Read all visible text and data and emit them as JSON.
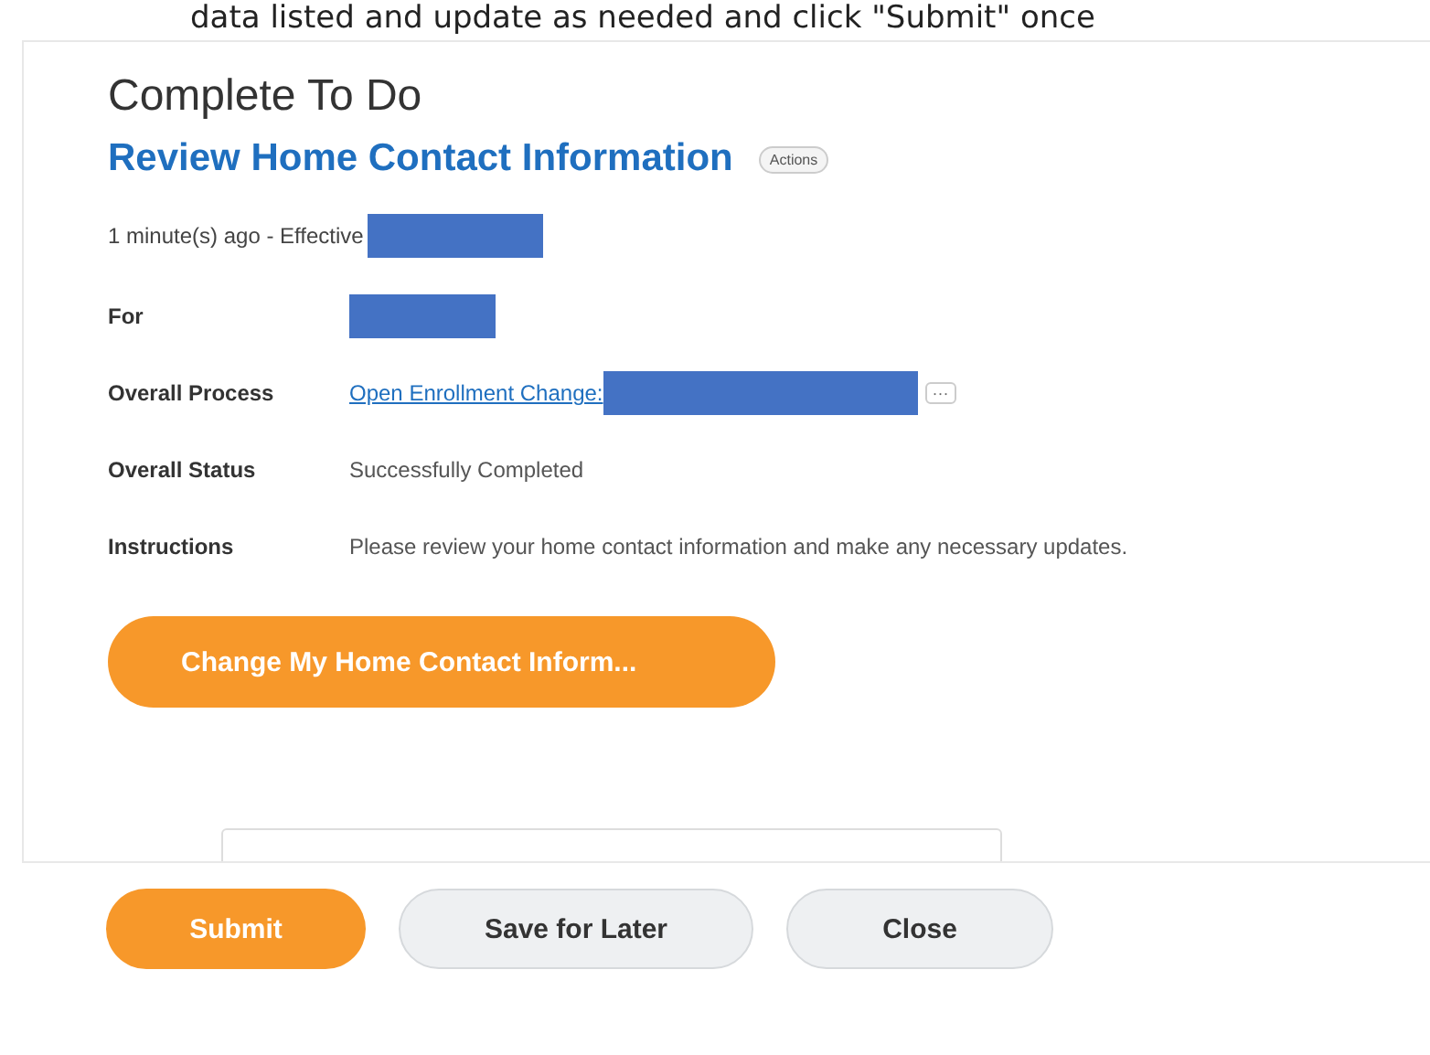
{
  "doc_line": "data listed and update as needed and click \"Submit\" once",
  "title": "Complete To Do",
  "subtitle": "Review Home Contact Information",
  "actions_label": "Actions",
  "timestamp": "1 minute(s) ago -  Effective",
  "fields": [
    {
      "label": "For",
      "kind": "redacted"
    },
    {
      "label": "Overall Process",
      "kind": "link",
      "value": "Open Enrollment Change:",
      "more": "···"
    },
    {
      "label": "Overall Status",
      "kind": "text",
      "value": "Successfully Completed"
    },
    {
      "label": "Instructions",
      "kind": "text",
      "value": "Please review your home contact information and make any necessary updates."
    }
  ],
  "action_button": "Change My Home Contact Inform...",
  "buttons": [
    {
      "label": "Submit",
      "kind": "primary"
    },
    {
      "label": "Save for Later",
      "kind": "secondary"
    },
    {
      "label": "Close",
      "kind": "secondary"
    }
  ]
}
